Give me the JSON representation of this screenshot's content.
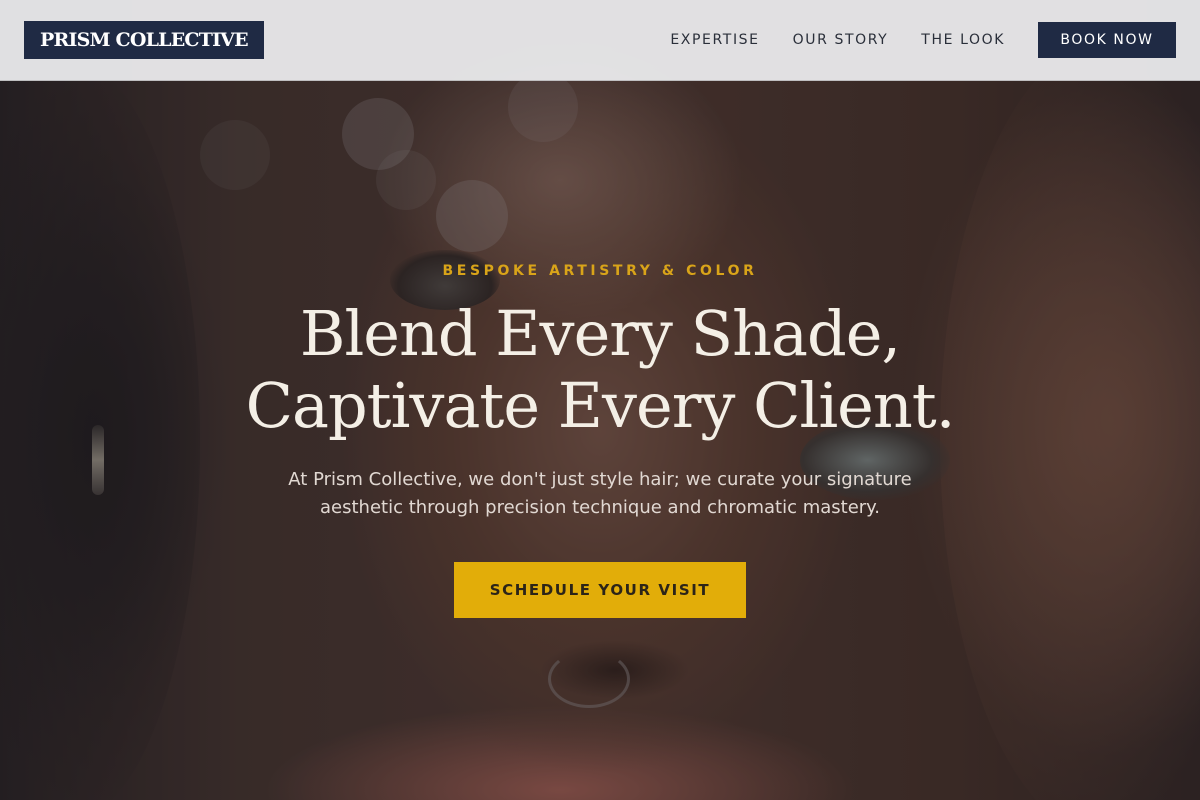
{
  "brand": {
    "name": "PRISM COLLECTIVE"
  },
  "nav": {
    "links": [
      {
        "label": "EXPERTISE"
      },
      {
        "label": "OUR STORY"
      },
      {
        "label": "THE LOOK"
      }
    ],
    "cta_label": "BOOK NOW"
  },
  "hero": {
    "eyebrow": "BESPOKE ARTISTRY & COLOR",
    "headline_line1": "Blend Every Shade,",
    "headline_line2": "Captivate Every Client.",
    "subtext": "At Prism Collective, we don't just style hair; we curate your signature aesthetic through precision technique and chromatic mastery.",
    "cta_label": "SCHEDULE YOUR VISIT"
  },
  "colors": {
    "navy": "#1f2a44",
    "gold": "#e2ad09",
    "eyebrow_gold": "#d9a419",
    "headline": "#f4efe6"
  }
}
